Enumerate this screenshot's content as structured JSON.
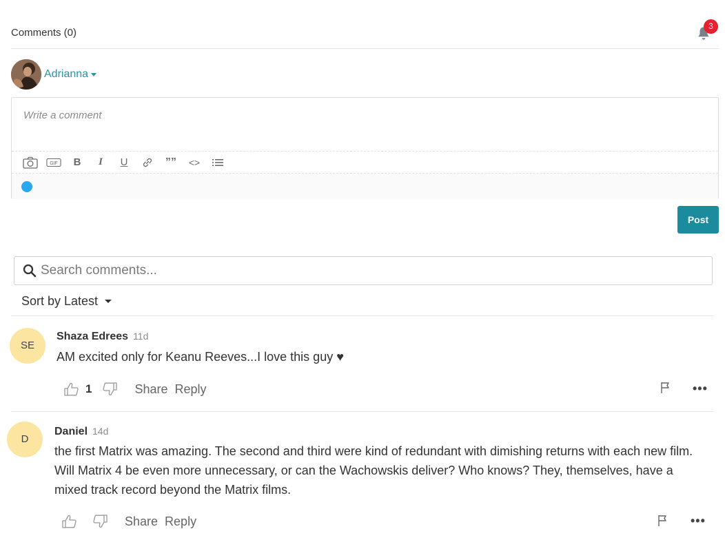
{
  "header": {
    "title": "Comments (0)",
    "notification_count": "3"
  },
  "user": {
    "name": "Adrianna"
  },
  "editor": {
    "placeholder": "Write a comment",
    "toolbar": [
      "camera-icon",
      "gif-icon",
      "bold-icon",
      "italic-icon",
      "underline-icon",
      "link-icon",
      "quote-icon",
      "code-icon",
      "list-icon"
    ],
    "toolbar_glyphs": {
      "bold": "B",
      "italic": "I",
      "underline": "U",
      "quote": "””",
      "code": "<>",
      "gif": "GIF"
    }
  },
  "post_button": "Post",
  "search": {
    "placeholder": "Search comments..."
  },
  "sort": {
    "label": "Sort by Latest"
  },
  "comments": [
    {
      "initials": "SE",
      "author": "Shaza Edrees",
      "time": "11d",
      "text": "AM excited only for Keanu Reeves...I love this guy ♥",
      "likes": "1",
      "share": "Share",
      "reply": "Reply"
    },
    {
      "initials": "D",
      "author": "Daniel",
      "time": "14d",
      "text": "the first Matrix was amazing. The second and third were kind of redundant with dimishing returns with each new film. Will Matrix 4 be even more unnecessary, or can the Wachowskis deliver? Who knows? They, themselves, have a mixed track record beyond the Matrix films.",
      "likes": "",
      "share": "Share",
      "reply": "Reply"
    }
  ],
  "more_glyph": "•••",
  "colors": {
    "accent": "#1a8c9e",
    "link": "#2a93a5",
    "badge": "#e8212e",
    "status_dot": "#29a8f0",
    "avatar_bg": "#fbe5a0"
  }
}
